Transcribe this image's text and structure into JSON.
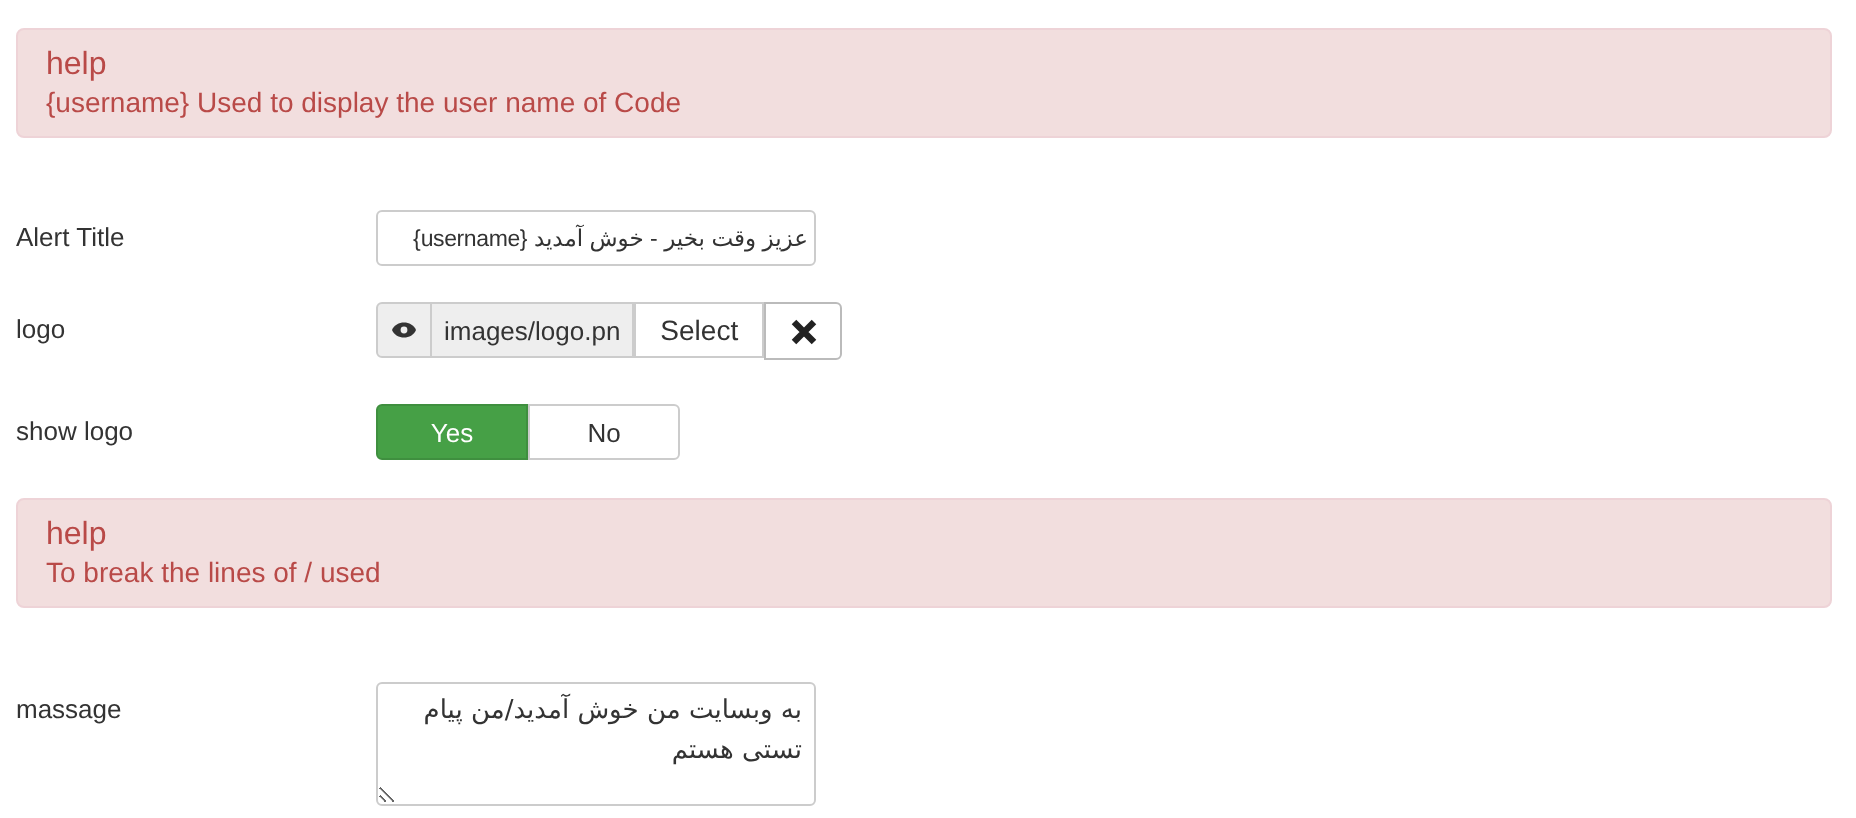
{
  "items": [
    {
      "kind": "help",
      "title": "help",
      "text": "{username} Used to display the user name of Code"
    },
    {
      "kind": "text",
      "label": "Alert Title",
      "value": "عزیز وقت بخیر - خوش آمدید {username}"
    },
    {
      "kind": "media",
      "label": "logo",
      "value": "images/logo.pn",
      "select": "Select"
    },
    {
      "kind": "toggle",
      "label": "show logo",
      "options": [
        {
          "label": "Yes",
          "selected": true
        },
        {
          "label": "No",
          "selected": false
        }
      ]
    },
    {
      "kind": "help",
      "title": "help",
      "text": "To break the lines of / used"
    },
    {
      "kind": "textarea",
      "label": "massage",
      "value": "به وبسایت من خوش آمدید/من پیام تستی هستم"
    }
  ]
}
